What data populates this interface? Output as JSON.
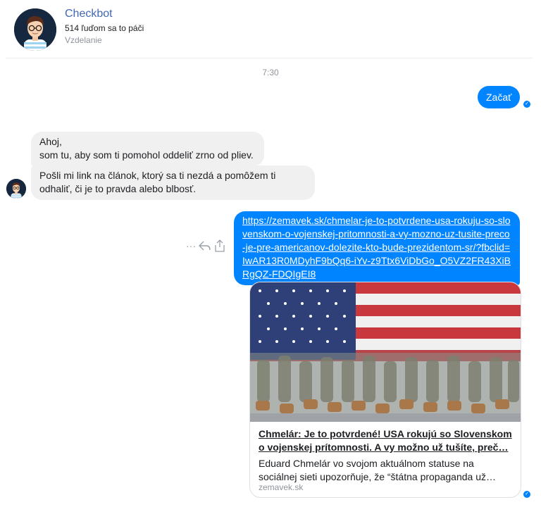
{
  "header": {
    "title": "Checkbot",
    "likes": "514 ľuďom sa to páči",
    "category": "Vzdelanie"
  },
  "chat": {
    "timestamp": "7:30",
    "outgoing_start": "Začať",
    "incoming_1_line1": "Ahoj,",
    "incoming_1_line2": "som tu, aby som ti pomohol oddeliť zrno od pliev.",
    "incoming_2": "Pošli mi link na článok, ktorý sa ti nezdá a pomôžem ti odhaliť, či je to pravda alebo blbosť.",
    "outgoing_link": "https://zemavek.sk/chmelar-je-to-potvrdene-usa-rokuju-so-slovenskom-o-vojenskej-pritomnosti-a-vy-mozno-uz-tusite-preco-je-pre-americanov-dolezite-kto-bude-prezidentom-sr/?fbclid=IwAR13R0MDyhF9bQq6-iYv-z9Ttx6ViDbGo_O5VZ2FR43XiBRgQZ-FDQIgEI8"
  },
  "preview": {
    "title": "Chmelár: Je to potvrdené! USA rokujú so Slovenskom o vojenskej prítomnosti. A vy možno už tušíte, preč…",
    "description": "Eduard Chmelár vo svojom aktuálnom statuse na sociálnej sieti upozorňuje, že “štátna propaganda už…",
    "domain": "zemavek.sk"
  },
  "icons": {
    "more": "more-icon",
    "reply": "reply-icon",
    "share": "share-icon",
    "seen": "seen-check-icon"
  },
  "colors": {
    "accent": "#0084ff",
    "page_title": "#4267b2",
    "incoming_bubble": "#f1f0f0"
  }
}
